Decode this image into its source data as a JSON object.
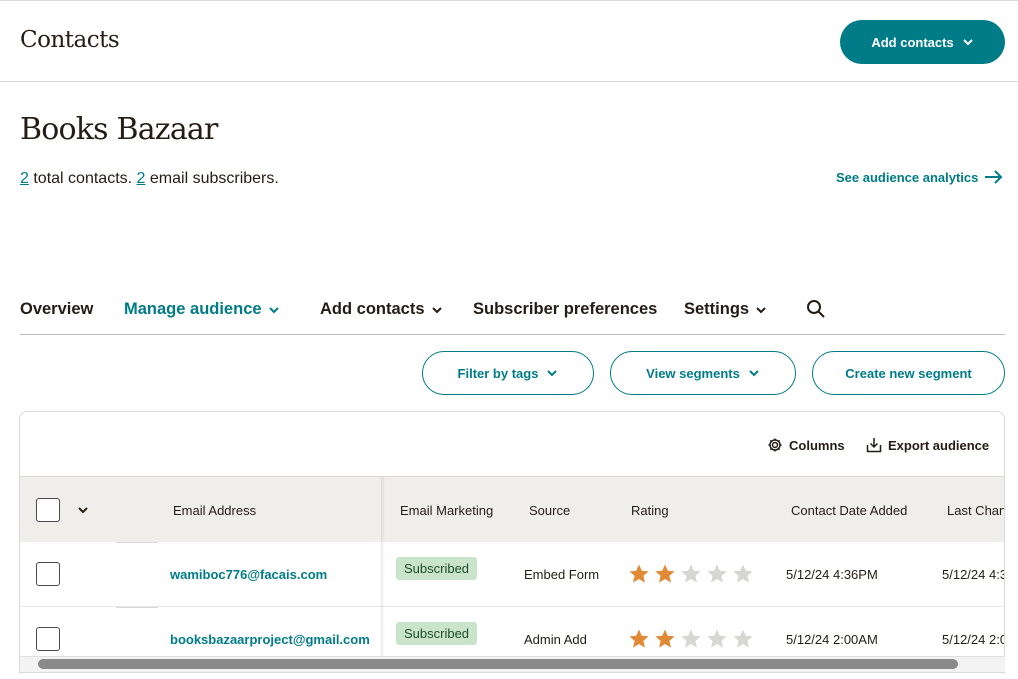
{
  "header": {
    "title": "Contacts",
    "add_contacts_button": "Add contacts"
  },
  "audience": {
    "name": "Books Bazaar",
    "total_contacts": "2",
    "total_contacts_text": "total contacts.",
    "email_subscribers": "2",
    "email_subscribers_text": "email subscribers.",
    "analytics_link": "See audience analytics"
  },
  "nav": {
    "items": [
      {
        "label": "Overview"
      },
      {
        "label": "Manage audience"
      },
      {
        "label": "Add contacts"
      },
      {
        "label": "Subscriber preferences"
      },
      {
        "label": "Settings"
      }
    ]
  },
  "filters": {
    "filter_by_tags": "Filter by tags",
    "view_segments": "View segments",
    "create_segment": "Create new segment"
  },
  "table": {
    "toolbar": {
      "columns": "Columns",
      "export": "Export audience"
    },
    "headers": [
      "Email Address",
      "Email Marketing",
      "Source",
      "Rating",
      "Contact Date Added",
      "Last Chan"
    ],
    "rows": [
      {
        "email": "wamiboc776@facais.com",
        "marketing": "Subscribed",
        "source": "Embed Form",
        "rating": 2,
        "added": "5/12/24 4:36PM",
        "last": "5/12/24 4:3"
      },
      {
        "email": "booksbazaarproject@gmail.com",
        "marketing": "Subscribed",
        "source": "Admin Add",
        "rating": 2,
        "added": "5/12/24 2:00AM",
        "last": "5/12/24 2:0"
      }
    ]
  },
  "colors": {
    "accent": "#007c89",
    "star_filled": "#e08a36",
    "star_empty": "#d6d6d2",
    "badge": "#c9e4ca",
    "header_bg": "#efeeea"
  }
}
